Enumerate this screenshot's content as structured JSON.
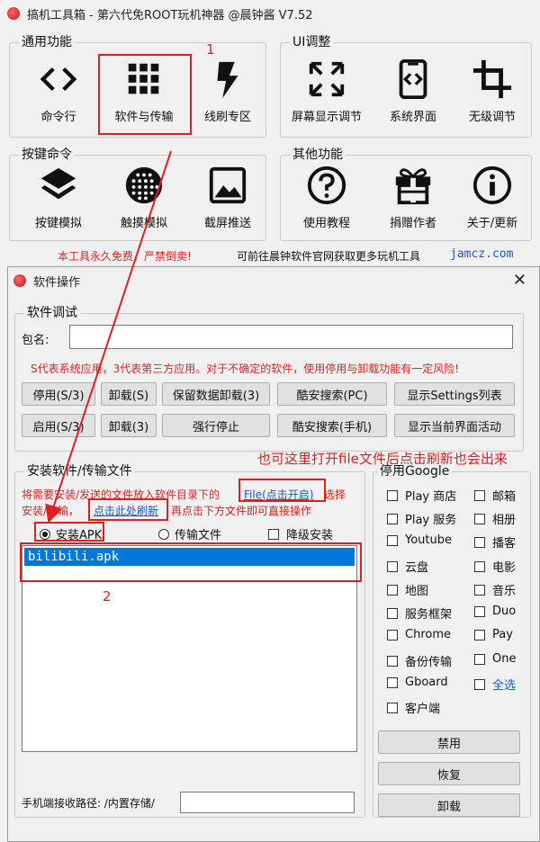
{
  "main_window": {
    "title": "搞机工具箱 - 第六代免ROOT玩机神器 @晨钟酱 V7.52",
    "groups": {
      "common": {
        "legend": "通用功能",
        "tools": [
          {
            "label": "命令行",
            "icon": "code-icon"
          },
          {
            "label": "软件与传输",
            "icon": "grid-icon"
          },
          {
            "label": "线刷专区",
            "icon": "flash-icon"
          }
        ]
      },
      "ui": {
        "legend": "UI调整",
        "tools": [
          {
            "label": "屏幕显示调节",
            "icon": "expand-icon"
          },
          {
            "label": "系统界面",
            "icon": "phone-code-icon"
          },
          {
            "label": "无级调节",
            "icon": "crop-icon"
          }
        ]
      },
      "keys": {
        "legend": "按键命令",
        "tools": [
          {
            "label": "按键模拟",
            "icon": "layers-icon"
          },
          {
            "label": "触摸模拟",
            "icon": "touch-dots-icon"
          },
          {
            "label": "截屏推送",
            "icon": "image-icon"
          }
        ]
      },
      "other": {
        "legend": "其他功能",
        "tools": [
          {
            "label": "使用教程",
            "icon": "help-icon"
          },
          {
            "label": "捐赠作者",
            "icon": "gift-icon"
          },
          {
            "label": "关于/更新",
            "icon": "info-icon"
          }
        ]
      }
    },
    "footer": {
      "warning": "本工具永久免费，严禁倒卖!",
      "text": "可前往晨钟软件官网获取更多玩机工具",
      "link": "jamcz.com"
    }
  },
  "annotations": {
    "one": "1",
    "two": "2",
    "hint": "也可这里打开file文件后点击刷新也会出来"
  },
  "dialog": {
    "title": "软件操作",
    "close": "✕",
    "debug": {
      "legend": "软件调试",
      "package_label": "包名:",
      "package_value": "",
      "warning": "S代表系统应用，3代表第三方应用。对于不确定的软件，使用停用与卸载功能有一定风险!",
      "buttons": {
        "disable_s3": "停用(S/3)",
        "uninstall_s": "卸载(S)",
        "keep_data_uninstall": "保留数据卸载(3)",
        "coolapk_pc": "酷安搜索(PC)",
        "show_settings": "显示Settings列表",
        "enable_s3": "启用(S/3)",
        "uninstall_3": "卸载(3)",
        "force_stop": "强行停止",
        "coolapk_phone": "酷安搜索(手机)",
        "show_activity": "显示当前界面活动"
      }
    },
    "install": {
      "legend": "安装软件/传输文件",
      "info_prefix": "将需要安装/发送的文件放入软件目录下的",
      "file_link": "File(点击开启)",
      "info_mid": "选择",
      "info_line2a": "安装/传输，",
      "refresh_link": "点击此处刷新",
      "info_line2b": "再点击下方文件即可直接操作",
      "radio_install": "安装APK",
      "radio_transfer": "传输文件",
      "check_downgrade": "降级安装",
      "files": [
        "bilibili.apk"
      ],
      "path_label": "手机端接收路径: /内置存储/",
      "path_value": ""
    },
    "google": {
      "legend": "停用Google",
      "items": [
        "Play 商店",
        "邮箱",
        "Play 服务",
        "相册",
        "Youtube",
        "播客",
        "云盘",
        "电影",
        "地图",
        "音乐",
        "服务框架",
        "Duo",
        "Chrome",
        "Pay",
        "备份传输",
        "One",
        "Gboard",
        "全选",
        "客户端"
      ],
      "btn_disable": "禁用",
      "btn_restore": "恢复",
      "btn_uninstall": "卸载"
    }
  }
}
